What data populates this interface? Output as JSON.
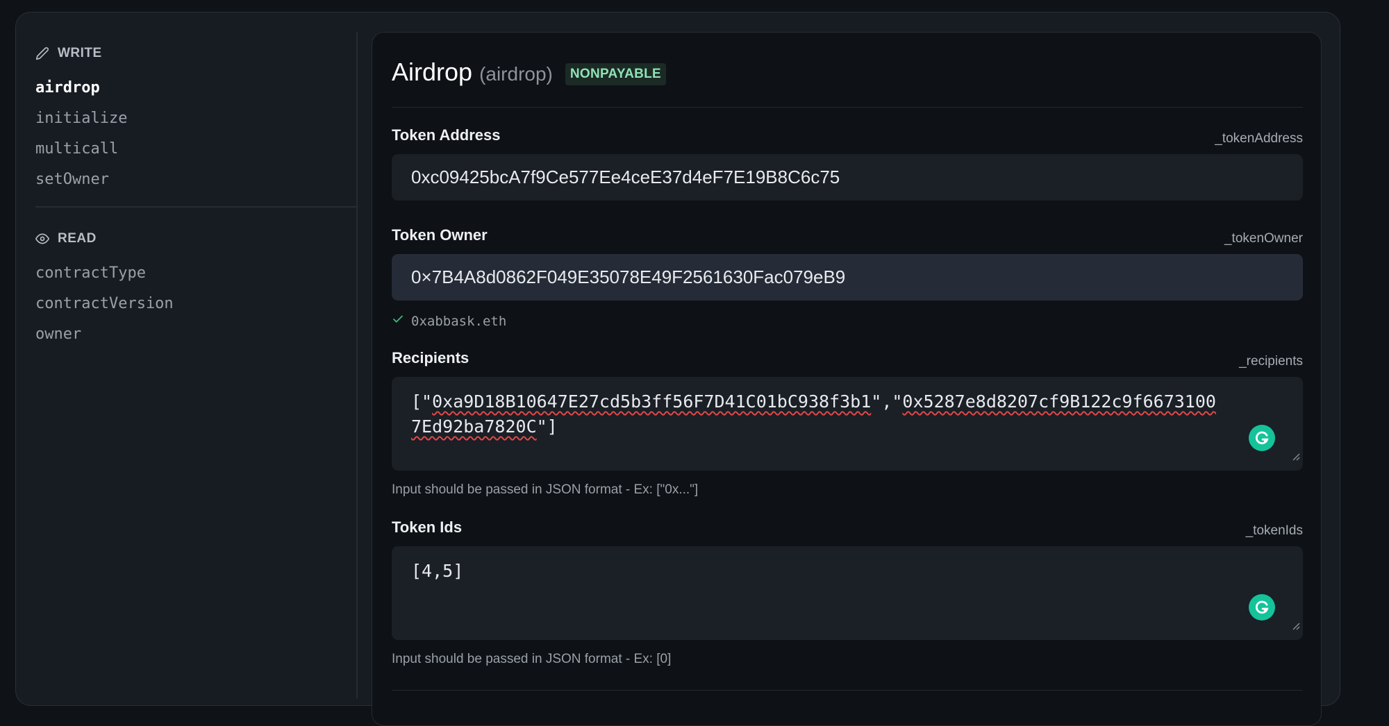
{
  "sidebar": {
    "write_heading": "WRITE",
    "write_icon": "pencil-icon",
    "write_items": [
      "airdrop",
      "initialize",
      "multicall",
      "setOwner"
    ],
    "active_item": "airdrop",
    "read_heading": "READ",
    "read_icon": "eye-icon",
    "read_items": [
      "contractType",
      "contractVersion",
      "owner"
    ]
  },
  "function": {
    "title": "Airdrop",
    "name": "(airdrop)",
    "badge": "NONPAYABLE"
  },
  "fields": {
    "token_address": {
      "label": "Token Address",
      "param": "_tokenAddress",
      "value": "0xc09425bcA7f9Ce577Ee4ceE37d4eF7E19B8C6c75"
    },
    "token_owner": {
      "label": "Token Owner",
      "param": "_tokenOwner",
      "value": "0×7B4A8d0862F049E35078E49F2561630Fac079eB9",
      "ens": "0xabbask.eth"
    },
    "recipients": {
      "label": "Recipients",
      "param": "_recipients",
      "value_prefix": "[\"",
      "addr1": "0xa9D18B10647E27cd5b3ff56F7D41C01bC938f3b1",
      "value_mid": "\",\"",
      "addr2_part1": "0x5287e8d8207cf9B122c9f6673100",
      "addr2_part2": "7Ed92ba7820C",
      "value_suffix": "\"]",
      "hint": "Input should be passed in JSON format - Ex: [\"0x...\"]"
    },
    "token_ids": {
      "label": "Token Ids",
      "param": "_tokenIds",
      "value": "[4,5]",
      "hint": "Input should be passed in JSON format - Ex: [0]"
    }
  },
  "colors": {
    "background": "#0f1217",
    "card": "#171c22",
    "panel": "#0e1115",
    "badge_text": "#8ee3b4",
    "grammarly": "#15c39a",
    "ens_check": "#3fb97a"
  }
}
